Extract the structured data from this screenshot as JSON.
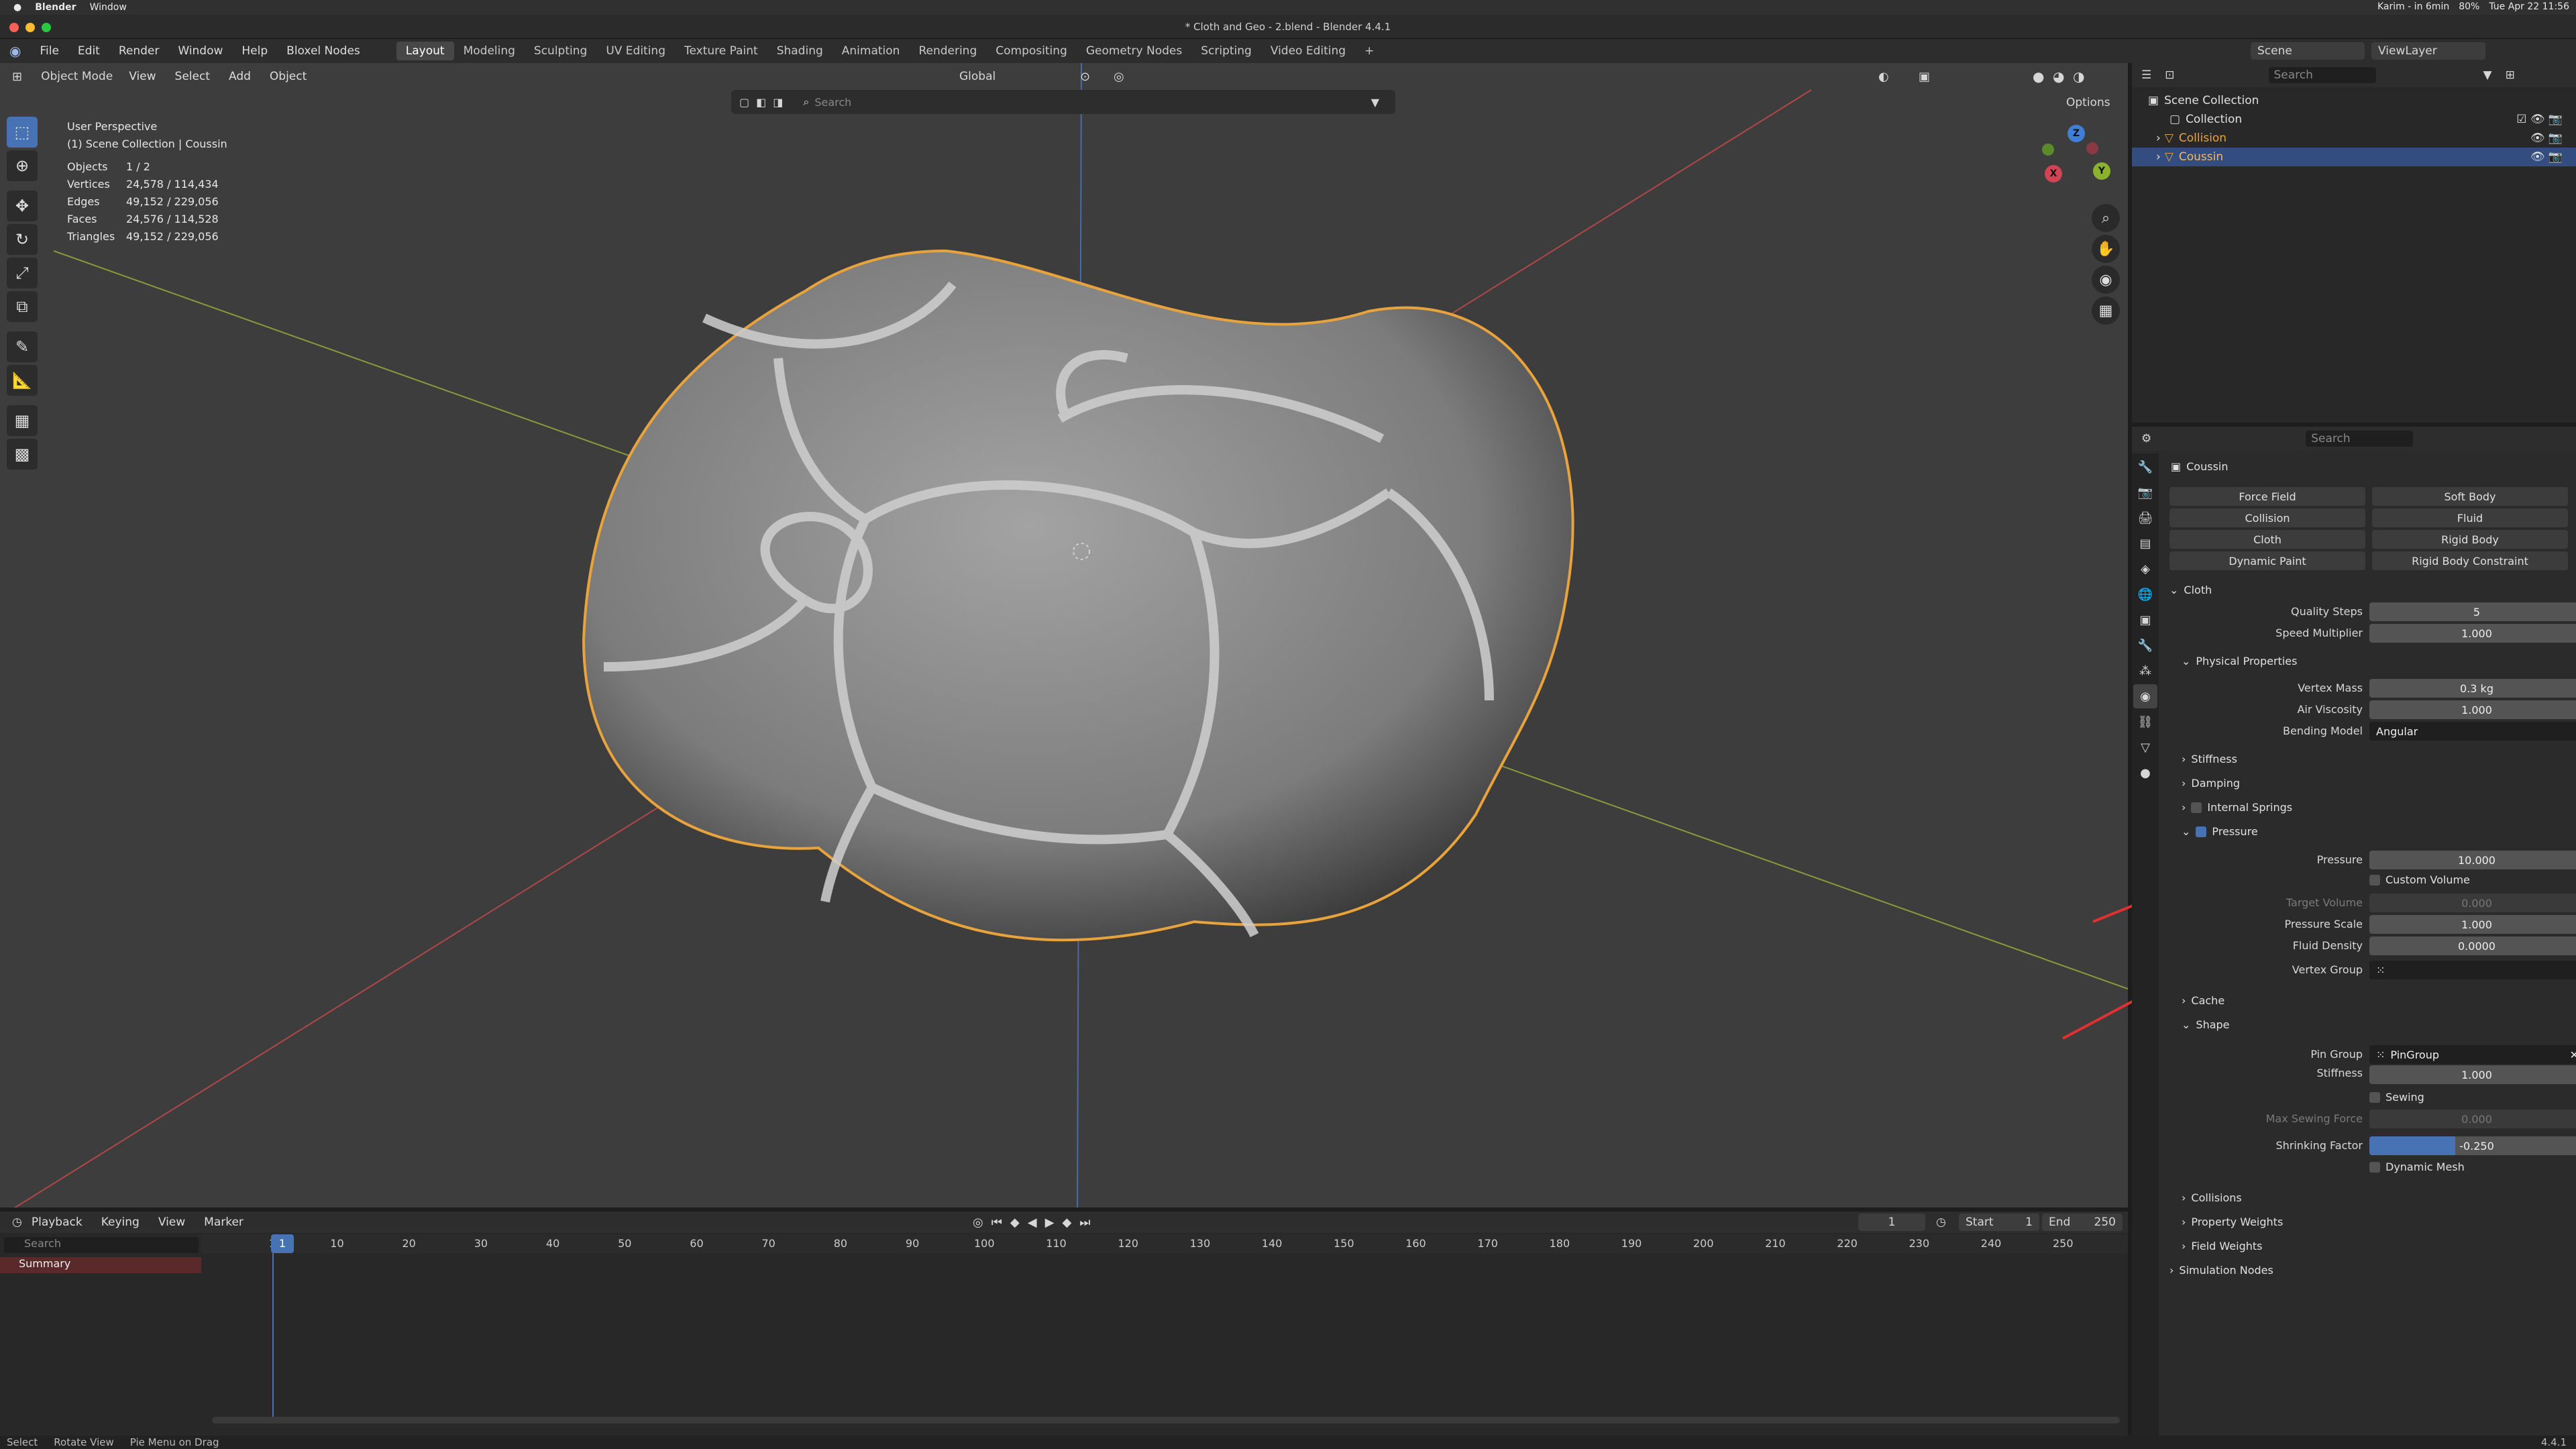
{
  "macbar": {
    "app": "Blender",
    "window": "Window",
    "status": "Karim - in 6min",
    "battery": "80%",
    "datetime": "Tue Apr 22 11:56"
  },
  "window_title": "* Cloth and Geo - 2.blend - Blender 4.4.1",
  "menus": [
    "File",
    "Edit",
    "Render",
    "Window",
    "Help",
    "Bloxel Nodes"
  ],
  "workspaces": [
    "Layout",
    "Modeling",
    "Sculpting",
    "UV Editing",
    "Texture Paint",
    "Shading",
    "Animation",
    "Rendering",
    "Compositing",
    "Geometry Nodes",
    "Scripting",
    "Video Editing"
  ],
  "active_workspace": "Layout",
  "scene": {
    "label": "Scene",
    "view_layer": "ViewLayer"
  },
  "viewport": {
    "mode": "Object Mode",
    "menus": [
      "View",
      "Select",
      "Add",
      "Object"
    ],
    "orientation": "Global",
    "options": "Options",
    "search_placeholder": "Search",
    "perspective": "User Perspective",
    "collection_line": "(1) Scene Collection | Coussin",
    "stats": [
      {
        "k": "Objects",
        "v": "1 / 2"
      },
      {
        "k": "Vertices",
        "v": "24,578 / 114,434"
      },
      {
        "k": "Edges",
        "v": "49,152 / 229,056"
      },
      {
        "k": "Faces",
        "v": "24,576 / 114,528"
      },
      {
        "k": "Triangles",
        "v": "49,152 / 229,056"
      }
    ]
  },
  "outliner": {
    "search_placeholder": "Search",
    "root": "Scene Collection",
    "items": [
      {
        "name": "Collection",
        "selected": false
      },
      {
        "name": "Collision",
        "selected": false
      },
      {
        "name": "Coussin",
        "selected": true
      }
    ]
  },
  "properties": {
    "search_placeholder": "Search",
    "object_name": "Coussin",
    "physics_buttons": [
      [
        "Force Field",
        "Soft Body"
      ],
      [
        "Collision",
        "Fluid"
      ],
      [
        "Cloth",
        "Rigid Body"
      ],
      [
        "Dynamic Paint",
        "Rigid Body Constraint"
      ]
    ],
    "cloth_header": "Cloth",
    "quality_steps": {
      "label": "Quality Steps",
      "value": "5"
    },
    "speed_multiplier": {
      "label": "Speed Multiplier",
      "value": "1.000"
    },
    "physical_properties": "Physical Properties",
    "vertex_mass": {
      "label": "Vertex Mass",
      "value": "0.3 kg"
    },
    "air_viscosity": {
      "label": "Air Viscosity",
      "value": "1.000"
    },
    "bending_model": {
      "label": "Bending Model",
      "value": "Angular"
    },
    "stiffness_sec": "Stiffness",
    "damping_sec": "Damping",
    "internal_springs_sec": "Internal Springs",
    "pressure_sec": "Pressure",
    "pressure": {
      "label": "Pressure",
      "value": "10.000"
    },
    "custom_volume": "Custom Volume",
    "target_volume": {
      "label": "Target Volume",
      "value": "0.000"
    },
    "pressure_scale": {
      "label": "Pressure Scale",
      "value": "1.000"
    },
    "fluid_density": {
      "label": "Fluid Density",
      "value": "0.0000"
    },
    "vertex_group": {
      "label": "Vertex Group",
      "value": ""
    },
    "cache_sec": "Cache",
    "shape_sec": "Shape",
    "pin_group": {
      "label": "Pin Group",
      "value": "PinGroup"
    },
    "shape_stiffness": {
      "label": "Stiffness",
      "value": "1.000"
    },
    "sewing": "Sewing",
    "max_sewing_force": {
      "label": "Max Sewing Force",
      "value": "0.000"
    },
    "shrinking_factor": {
      "label": "Shrinking Factor",
      "value": "-0.250",
      "fill": 0.4
    },
    "dynamic_mesh": "Dynamic Mesh",
    "collisions_sec": "Collisions",
    "property_weights_sec": "Property Weights",
    "field_weights_sec": "Field Weights",
    "simulation_nodes_sec": "Simulation Nodes"
  },
  "timeline": {
    "menus": [
      "Playback",
      "Keying",
      "View",
      "Marker"
    ],
    "current_frame": "1",
    "start_label": "Start",
    "start": "1",
    "end_label": "End",
    "end": "250",
    "search_placeholder": "Search",
    "summary": "Summary",
    "ticks": [
      "1",
      "10",
      "20",
      "30",
      "40",
      "50",
      "60",
      "70",
      "80",
      "90",
      "100",
      "110",
      "120",
      "130",
      "140",
      "150",
      "160",
      "170",
      "180",
      "190",
      "200",
      "210",
      "220",
      "230",
      "240",
      "250"
    ]
  },
  "statusbar": [
    "Select",
    "Rotate View",
    "Pie Menu on Drag"
  ],
  "version": "4.4.1",
  "colors": {
    "accent": "#4772b3",
    "selection": "#e8a33c",
    "annotation": "#e03030"
  }
}
